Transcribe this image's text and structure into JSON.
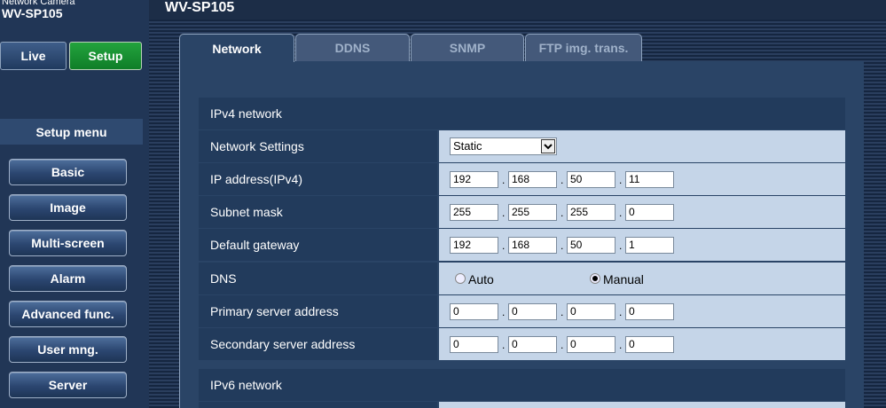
{
  "header": {
    "product_subtitle": "Network Camera",
    "model": "WV-SP105",
    "page_title": "WV-SP105"
  },
  "mode_buttons": {
    "live": "Live",
    "setup": "Setup"
  },
  "setup_menu": {
    "title": "Setup menu",
    "items": [
      "Basic",
      "Image",
      "Multi-screen",
      "Alarm",
      "Advanced func.",
      "User mng.",
      "Server"
    ]
  },
  "tabs": [
    "Network",
    "DDNS",
    "SNMP",
    "FTP img. trans."
  ],
  "ipv4": {
    "title": "IPv4 network",
    "network_settings": {
      "label": "Network Settings",
      "value": "Static"
    },
    "ip_address": {
      "label": "IP address(IPv4)",
      "octets": [
        "192",
        "168",
        "50",
        "11"
      ]
    },
    "subnet_mask": {
      "label": "Subnet mask",
      "octets": [
        "255",
        "255",
        "255",
        "0"
      ]
    },
    "default_gateway": {
      "label": "Default gateway",
      "octets": [
        "192",
        "168",
        "50",
        "1"
      ]
    },
    "dns": {
      "label": "DNS",
      "auto_label": "Auto",
      "manual_label": "Manual",
      "selected": "Manual"
    },
    "primary_server": {
      "label": "Primary server address",
      "octets": [
        "0",
        "0",
        "0",
        "0"
      ]
    },
    "secondary_server": {
      "label": "Secondary server address",
      "octets": [
        "0",
        "0",
        "0",
        "0"
      ]
    }
  },
  "ipv6": {
    "title": "IPv6 network"
  },
  "colors": {
    "background": "#1d2f4a",
    "panel": "#2a4466",
    "value_cell": "#c5d5e8",
    "setup_green": "#23a33d"
  }
}
